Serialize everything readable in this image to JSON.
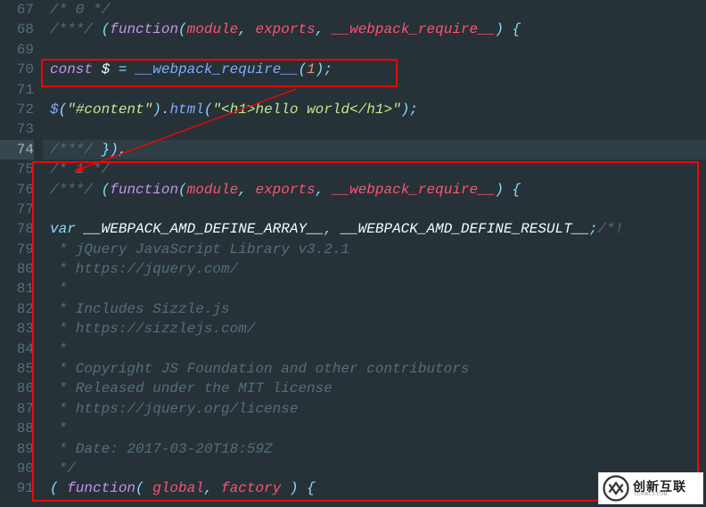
{
  "gutter": {
    "start": 67,
    "end": 91,
    "highlighted": 74
  },
  "lines": {
    "67": {
      "type": "comment",
      "text": "/* 0 */"
    },
    "68": {
      "type": "mixed",
      "pre_comment": "/***/",
      "fn_kw": "function",
      "params": [
        "module",
        "exports",
        "__webpack_require__"
      ]
    },
    "69": {
      "type": "blank"
    },
    "70": {
      "type": "const_require",
      "kw": "const",
      "var": "$",
      "call": "__webpack_require__",
      "arg": "1"
    },
    "71": {
      "type": "blank"
    },
    "72": {
      "type": "jquery_line",
      "sel": "\"#content\"",
      "method": "html",
      "arg": "\"<h1>hello world</h1>\""
    },
    "73": {
      "type": "blank"
    },
    "74": {
      "type": "close_mod",
      "pre_comment": "/***/"
    },
    "75": {
      "type": "comment",
      "text": "/* 1 */"
    },
    "76": {
      "type": "mixed",
      "pre_comment": "/***/",
      "fn_kw": "function",
      "params": [
        "module",
        "exports",
        "__webpack_require__"
      ]
    },
    "77": {
      "type": "blank"
    },
    "78": {
      "type": "var_decl",
      "kw": "var",
      "names": [
        "__WEBPACK_AMD_DEFINE_ARRAY__",
        "__WEBPACK_AMD_DEFINE_RESULT__"
      ],
      "trail_comment": "/*!"
    },
    "79": {
      "type": "comment",
      "text": " * jQuery JavaScript Library v3.2.1"
    },
    "80": {
      "type": "comment",
      "text": " * https://jquery.com/"
    },
    "81": {
      "type": "comment",
      "text": " *"
    },
    "82": {
      "type": "comment",
      "text": " * Includes Sizzle.js"
    },
    "83": {
      "type": "comment",
      "text": " * https://sizzlejs.com/"
    },
    "84": {
      "type": "comment",
      "text": " *"
    },
    "85": {
      "type": "comment",
      "text": " * Copyright JS Foundation and other contributors"
    },
    "86": {
      "type": "comment",
      "text": " * Released under the MIT license"
    },
    "87": {
      "type": "comment",
      "text": " * https://jquery.org/license"
    },
    "88": {
      "type": "comment",
      "text": " *"
    },
    "89": {
      "type": "comment",
      "text": " * Date: 2017-03-20T18:59Z"
    },
    "90": {
      "type": "comment",
      "text": " */"
    },
    "91": {
      "type": "fn_call_open",
      "fn_kw": "function",
      "params": [
        "global",
        "factory"
      ]
    }
  },
  "watermark": {
    "cn": "创新互联",
    "en": "CDXWCX.COM"
  }
}
